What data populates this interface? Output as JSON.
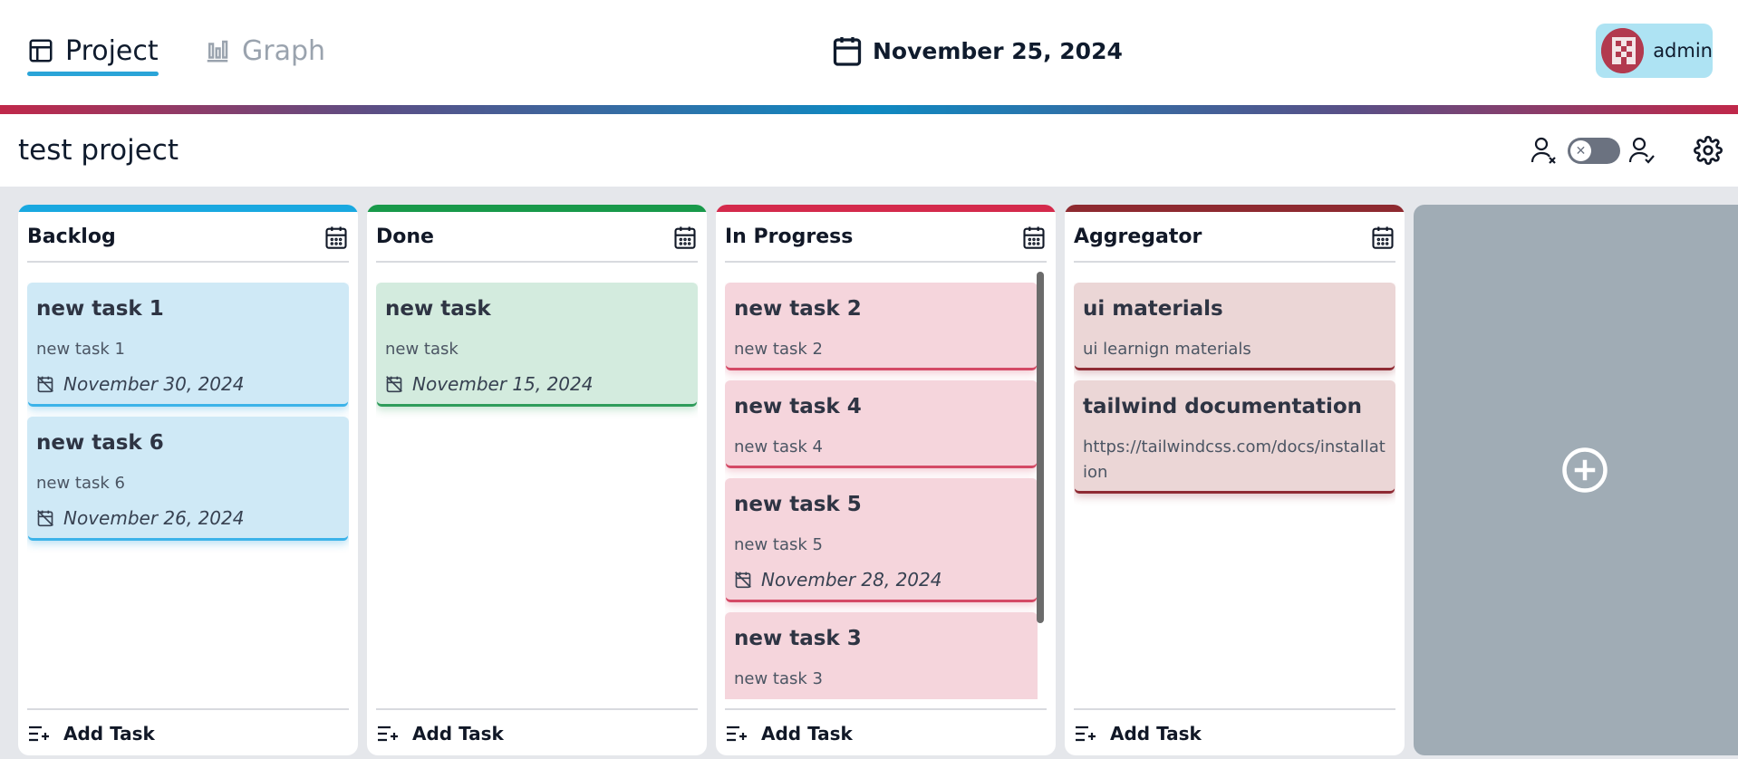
{
  "nav": {
    "tabs": [
      {
        "label": "Project",
        "icon": "table-layout-icon",
        "active": true
      },
      {
        "label": "Graph",
        "icon": "bar-chart-icon",
        "active": false
      }
    ],
    "current_date": "November 25, 2024",
    "user": {
      "name": "admin"
    }
  },
  "project": {
    "title": "test project"
  },
  "columns": [
    {
      "name": "Backlog",
      "color": "#19a8e0",
      "tasks": [
        {
          "title": "new task 1",
          "desc": "new task 1",
          "due": "November 30, 2024"
        },
        {
          "title": "new task 6",
          "desc": "new task 6",
          "due": "November 26, 2024"
        }
      ]
    },
    {
      "name": "Done",
      "color": "#18994a",
      "tasks": [
        {
          "title": "new task",
          "desc": "new task",
          "due": "November 15, 2024"
        }
      ]
    },
    {
      "name": "In Progress",
      "color": "#d42a4c",
      "tasks": [
        {
          "title": "new task 2",
          "desc": "new task 2"
        },
        {
          "title": "new task 4",
          "desc": "new task 4"
        },
        {
          "title": "new task 5",
          "desc": "new task 5",
          "due": "November 28, 2024"
        },
        {
          "title": "new task 3",
          "desc": "new task 3"
        }
      ]
    },
    {
      "name": "Aggregator",
      "color": "#8e2a30",
      "tasks": [
        {
          "title": "ui materials",
          "desc": "ui learnign materials"
        },
        {
          "title": "tailwind documentation",
          "desc": "https://tailwindcss.com/docs/installation"
        }
      ]
    }
  ],
  "add_task_label": "Add Task",
  "colors": {
    "accent": "#2aa4d8",
    "add_column_bg": "#a0acb5"
  }
}
